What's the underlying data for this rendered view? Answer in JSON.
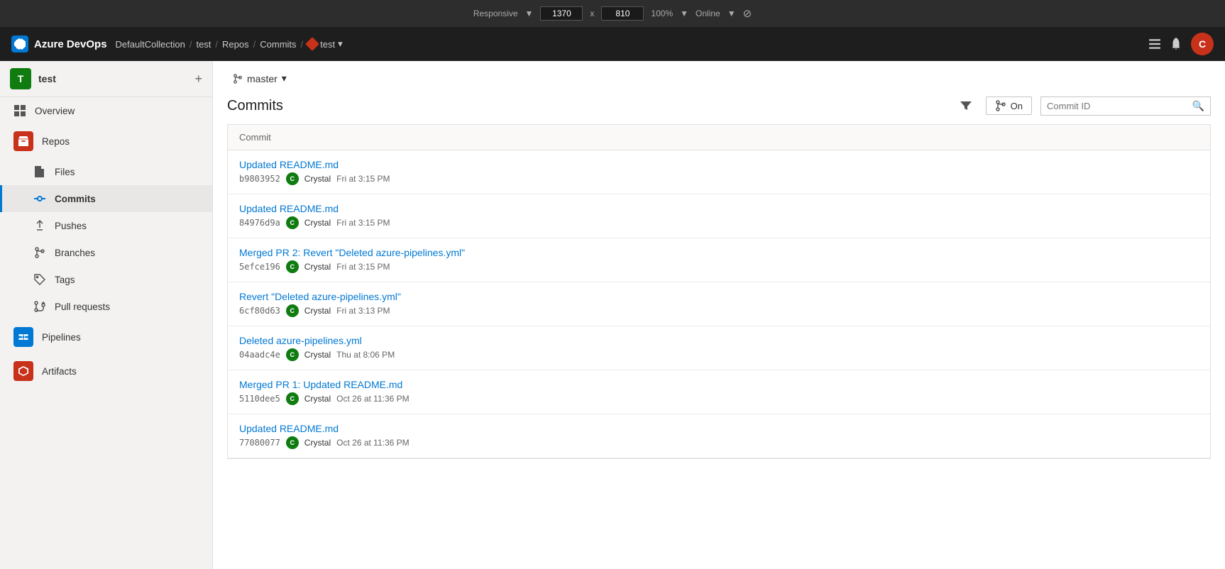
{
  "browser": {
    "mode": "Responsive",
    "width": "1370",
    "x": "x",
    "height": "810",
    "zoom": "100%",
    "connection": "Online"
  },
  "header": {
    "logo_text": "Azure DevOps",
    "breadcrumb": [
      {
        "label": "DefaultCollection",
        "link": true
      },
      {
        "label": "/"
      },
      {
        "label": "test",
        "link": true
      },
      {
        "label": "/"
      },
      {
        "label": "Repos",
        "link": true
      },
      {
        "label": "/"
      },
      {
        "label": "Commits",
        "link": true
      },
      {
        "label": "/"
      },
      {
        "label": "test",
        "link": true,
        "has_icon": true
      }
    ],
    "user_initial": "C"
  },
  "sidebar": {
    "team_name": "test",
    "team_initial": "T",
    "nav_items": [
      {
        "label": "Overview",
        "icon": "overview-icon",
        "active": false
      },
      {
        "label": "Repos",
        "icon": "repos-icon",
        "active": false,
        "colored": true,
        "color": "#c8311a"
      },
      {
        "label": "Files",
        "icon": "files-icon",
        "active": false
      },
      {
        "label": "Commits",
        "icon": "commits-icon",
        "active": true
      },
      {
        "label": "Pushes",
        "icon": "pushes-icon",
        "active": false
      },
      {
        "label": "Branches",
        "icon": "branches-icon",
        "active": false
      },
      {
        "label": "Tags",
        "icon": "tags-icon",
        "active": false
      },
      {
        "label": "Pull requests",
        "icon": "pull-requests-icon",
        "active": false
      },
      {
        "label": "Pipelines",
        "icon": "pipelines-icon",
        "active": false,
        "colored": true,
        "color": "#0078d4"
      },
      {
        "label": "Artifacts",
        "icon": "artifacts-icon",
        "active": false,
        "colored": true,
        "color": "#c8311a"
      }
    ]
  },
  "main": {
    "branch": "master",
    "page_title": "Commits",
    "filter_label": "On",
    "commit_id_placeholder": "Commit ID",
    "table_header": "Commit",
    "commits": [
      {
        "message": "Updated README.md",
        "hash": "b9803952",
        "author": "Crystal",
        "time": "Fri at 3:15 PM"
      },
      {
        "message": "Updated README.md",
        "hash": "84976d9a",
        "author": "Crystal",
        "time": "Fri at 3:15 PM"
      },
      {
        "message": "Merged PR 2: Revert \"Deleted azure-pipelines.yml\"",
        "hash": "5efce196",
        "author": "Crystal",
        "time": "Fri at 3:15 PM"
      },
      {
        "message": "Revert \"Deleted azure-pipelines.yml\"",
        "hash": "6cf80d63",
        "author": "Crystal",
        "time": "Fri at 3:13 PM"
      },
      {
        "message": "Deleted azure-pipelines.yml",
        "hash": "04aadc4e",
        "author": "Crystal",
        "time": "Thu at 8:06 PM"
      },
      {
        "message": "Merged PR 1: Updated README.md",
        "hash": "5110dee5",
        "author": "Crystal",
        "time": "Oct 26 at 11:36 PM"
      },
      {
        "message": "Updated README.md",
        "hash": "77080077",
        "author": "Crystal",
        "time": "Oct 26 at 11:36 PM"
      }
    ]
  }
}
